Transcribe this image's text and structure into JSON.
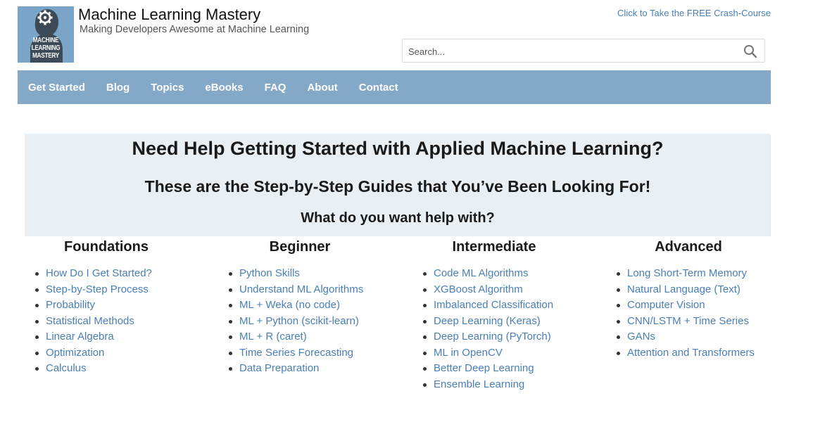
{
  "header": {
    "logo_lines": [
      "MACHINE",
      "LEARNING",
      "MASTERY"
    ],
    "site_title": "Machine Learning Mastery",
    "tagline": "Making Developers Awesome at Machine Learning",
    "crash_course_link": "Click to Take the FREE Crash-Course"
  },
  "search": {
    "placeholder": "Search...",
    "icon": "search-icon"
  },
  "nav": {
    "items": [
      "Get Started",
      "Blog",
      "Topics",
      "eBooks",
      "FAQ",
      "About",
      "Contact"
    ]
  },
  "hero": {
    "headline": "Need Help Getting Started with Applied Machine Learning?",
    "subheadline": "These are the Step-by-Step Guides that You’ve Been Looking For!",
    "question": "What do you want help with?"
  },
  "columns": [
    {
      "title": "Foundations",
      "links": [
        "How Do I Get Started?",
        "Step-by-Step Process",
        "Probability",
        "Statistical Methods",
        "Linear Algebra",
        "Optimization",
        "Calculus"
      ]
    },
    {
      "title": "Beginner",
      "links": [
        "Python Skills",
        "Understand ML Algorithms",
        "ML + Weka (no code)",
        "ML + Python (scikit-learn)",
        "ML + R (caret)",
        "Time Series Forecasting",
        "Data Preparation"
      ]
    },
    {
      "title": "Intermediate",
      "links": [
        "Code ML Algorithms",
        "XGBoost Algorithm",
        "Imbalanced Classification",
        "Deep Learning (Keras)",
        "Deep Learning (PyTorch)",
        "ML in OpenCV",
        "Better Deep Learning",
        "Ensemble Learning"
      ]
    },
    {
      "title": "Advanced",
      "links": [
        "Long Short-Term Memory",
        "Natural Language (Text)",
        "Computer Vision",
        "CNN/LSTM + Time Series",
        "GANs",
        "Attention and Transformers"
      ]
    }
  ],
  "colors": {
    "nav_bg": "#84a9c8",
    "hero_bg": "#e9f0f5",
    "link": "#4a7fb5",
    "logo_bg": "#7ba5c8"
  }
}
